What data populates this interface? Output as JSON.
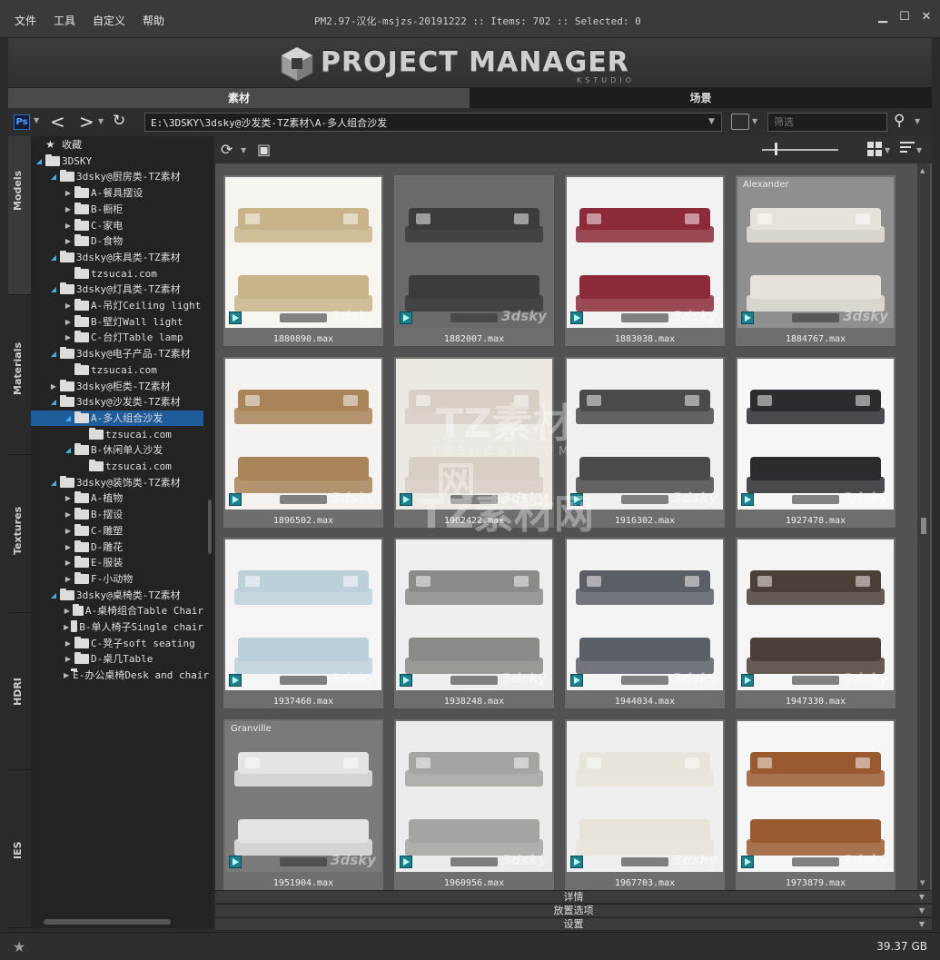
{
  "menu": [
    "文件",
    "工具",
    "自定义",
    "帮助"
  ],
  "window_title": "PM2.97-汉化-msjzs-20191222  :: Items: 702  :: Selected: 0",
  "banner": {
    "title": "PROJECT MANAGER",
    "subtitle": "KSTUDIO"
  },
  "main_tabs": [
    {
      "label": "素材",
      "active": true
    },
    {
      "label": "场景",
      "active": false
    }
  ],
  "pathbar": {
    "path": "E:\\3DSKY\\3dsky@沙发类-TZ素材\\A-多人组合沙发",
    "filter_placeholder": "筛选"
  },
  "side_tabs": [
    "Models",
    "Materials",
    "Textures",
    "HDRI",
    "IES"
  ],
  "tree": [
    {
      "label": "收藏",
      "level": 0,
      "icon": "star-icon",
      "arrow": ""
    },
    {
      "label": "3DSKY",
      "level": 0,
      "icon": "folder-icon",
      "arrow": "expanded"
    },
    {
      "label": "3dsky@厨房类-TZ素材",
      "level": 1,
      "icon": "folder-icon",
      "arrow": "expanded"
    },
    {
      "label": "A-餐具摆设",
      "level": 2,
      "icon": "folder-icon",
      "arrow": "collapsed"
    },
    {
      "label": "B-橱柜",
      "level": 2,
      "icon": "folder-icon",
      "arrow": "collapsed"
    },
    {
      "label": "C-家电",
      "level": 2,
      "icon": "folder-icon",
      "arrow": "collapsed"
    },
    {
      "label": "D-食物",
      "level": 2,
      "icon": "folder-icon",
      "arrow": "collapsed"
    },
    {
      "label": "3dsky@床具类-TZ素材",
      "level": 1,
      "icon": "folder-icon",
      "arrow": "expanded"
    },
    {
      "label": "tzsucai.com",
      "level": 2,
      "icon": "folder-icon",
      "arrow": ""
    },
    {
      "label": "3dsky@灯具类-TZ素材",
      "level": 1,
      "icon": "folder-icon",
      "arrow": "expanded"
    },
    {
      "label": "A-吊灯Ceiling light",
      "level": 2,
      "icon": "folder-icon",
      "arrow": "collapsed"
    },
    {
      "label": "B-壁灯Wall light",
      "level": 2,
      "icon": "folder-icon",
      "arrow": "collapsed"
    },
    {
      "label": "C-台灯Table lamp",
      "level": 2,
      "icon": "folder-icon",
      "arrow": "collapsed"
    },
    {
      "label": "3dsky@电子产品-TZ素材",
      "level": 1,
      "icon": "folder-icon",
      "arrow": "expanded"
    },
    {
      "label": "tzsucai.com",
      "level": 2,
      "icon": "folder-icon",
      "arrow": ""
    },
    {
      "label": "3dsky@柜类-TZ素材",
      "level": 1,
      "icon": "folder-icon",
      "arrow": "collapsed"
    },
    {
      "label": "3dsky@沙发类-TZ素材",
      "level": 1,
      "icon": "folder-icon",
      "arrow": "expanded"
    },
    {
      "label": "A-多人组合沙发",
      "level": 2,
      "icon": "folder-icon",
      "arrow": "expanded",
      "selected": true
    },
    {
      "label": "tzsucai.com",
      "level": 3,
      "icon": "folder-icon",
      "arrow": ""
    },
    {
      "label": "B-休闲单人沙发",
      "level": 2,
      "icon": "folder-icon",
      "arrow": "expanded"
    },
    {
      "label": "tzsucai.com",
      "level": 3,
      "icon": "folder-icon",
      "arrow": ""
    },
    {
      "label": "3dsky@装饰类-TZ素材",
      "level": 1,
      "icon": "folder-icon",
      "arrow": "expanded"
    },
    {
      "label": "A-植物",
      "level": 2,
      "icon": "folder-icon",
      "arrow": "collapsed"
    },
    {
      "label": "B-摆设",
      "level": 2,
      "icon": "folder-icon",
      "arrow": "collapsed"
    },
    {
      "label": "C-雕塑",
      "level": 2,
      "icon": "folder-icon",
      "arrow": "collapsed"
    },
    {
      "label": "D-雕花",
      "level": 2,
      "icon": "folder-icon",
      "arrow": "collapsed"
    },
    {
      "label": "E-服装",
      "level": 2,
      "icon": "folder-icon",
      "arrow": "collapsed"
    },
    {
      "label": "F-小动物",
      "level": 2,
      "icon": "folder-icon",
      "arrow": "collapsed"
    },
    {
      "label": "3dsky@桌椅类-TZ素材",
      "level": 1,
      "icon": "folder-icon",
      "arrow": "expanded"
    },
    {
      "label": "A-桌椅组合Table Chair",
      "level": 2,
      "icon": "folder-icon",
      "arrow": "collapsed"
    },
    {
      "label": "B-单人椅子Single chair",
      "level": 2,
      "icon": "folder-icon",
      "arrow": "collapsed"
    },
    {
      "label": "C-凳子soft seating",
      "level": 2,
      "icon": "folder-icon",
      "arrow": "collapsed"
    },
    {
      "label": "D-桌几Table",
      "level": 2,
      "icon": "folder-icon",
      "arrow": "collapsed"
    },
    {
      "label": "E-办公桌椅Desk and chair",
      "level": 2,
      "icon": "folder-icon",
      "arrow": "collapsed"
    }
  ],
  "items": [
    {
      "name": "1880890.max",
      "bg": "#f6f4ef",
      "sofa": "#c9b48a",
      "label": ""
    },
    {
      "name": "1882007.max",
      "bg": "#6a6a6a",
      "sofa": "#3c3c3c",
      "label": ""
    },
    {
      "name": "1883038.max",
      "bg": "#f2f2f2",
      "sofa": "#8c2a3a",
      "label": ""
    },
    {
      "name": "1884767.max",
      "bg": "#8f8f8f",
      "sofa": "#e6e2da",
      "label": "Alexander"
    },
    {
      "name": "1896502.max",
      "bg": "#f4f2ee",
      "sofa": "#a88458",
      "label": ""
    },
    {
      "name": "1902422.max",
      "bg": "#ece8e2",
      "sofa": "#d8cfc4",
      "label": ""
    },
    {
      "name": "1916302.max",
      "bg": "#f0f0f0",
      "sofa": "#4a4a4a",
      "label": ""
    },
    {
      "name": "1927478.max",
      "bg": "#f7f7f7",
      "sofa": "#2a2c30",
      "label": ""
    },
    {
      "name": "1937460.max",
      "bg": "#f4f4f4",
      "sofa": "#bcd0da",
      "label": ""
    },
    {
      "name": "1938248.max",
      "bg": "#eeeeee",
      "sofa": "#8a8a86",
      "label": ""
    },
    {
      "name": "1944034.max",
      "bg": "#f3f3f3",
      "sofa": "#5a5f66",
      "label": ""
    },
    {
      "name": "1947330.max",
      "bg": "#f4f4f4",
      "sofa": "#4a4038",
      "label": ""
    },
    {
      "name": "1951904.max",
      "bg": "#7a7a7a",
      "sofa": "#e4e4e4",
      "label": "Granville"
    },
    {
      "name": "1960956.max",
      "bg": "#ececec",
      "sofa": "#a4a4a0",
      "label": ""
    },
    {
      "name": "1967703.max",
      "bg": "#efefef",
      "sofa": "#e8e4da",
      "label": ""
    },
    {
      "name": "1973879.max",
      "bg": "#f6f6f6",
      "sofa": "#9a5a30",
      "label": ""
    }
  ],
  "thumb_watermark": "3dsky",
  "overlay_watermark": {
    "line1": "TZ素材网",
    "line2": "TZSUCAI.COM",
    "line3": "TZ素材网"
  },
  "sections": [
    "详情",
    "放置选项",
    "设置"
  ],
  "status": {
    "disk_space": "39.37 GB"
  }
}
